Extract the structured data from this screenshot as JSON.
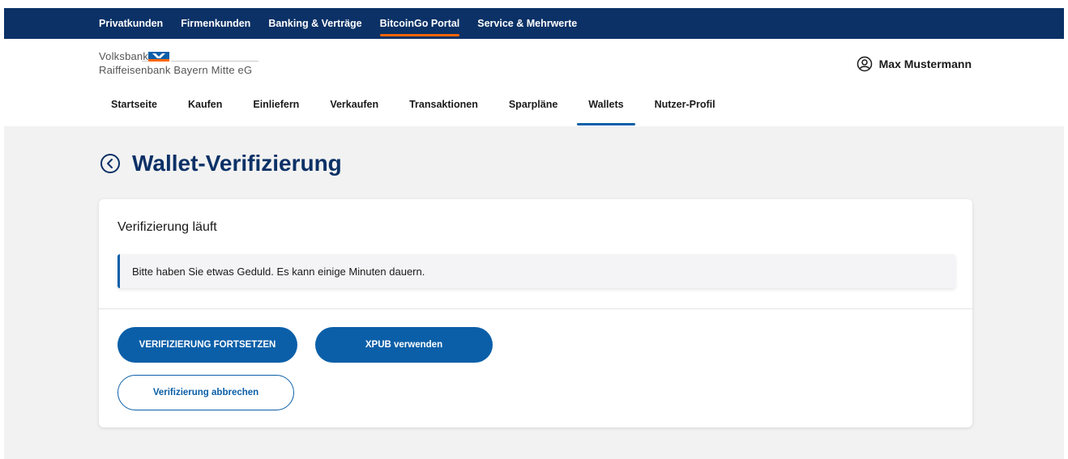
{
  "topnav": {
    "items": [
      {
        "label": "Privatkunden"
      },
      {
        "label": "Firmenkunden"
      },
      {
        "label": "Banking & Verträge"
      },
      {
        "label": "BitcoinGo Portal",
        "active": true
      },
      {
        "label": "Service & Mehrwerte"
      }
    ]
  },
  "header": {
    "logo_line1": "Volksbank",
    "logo_line2": "Raiffeisenbank Bayern Mitte eG",
    "user_name": "Max Mustermann"
  },
  "subnav": {
    "items": [
      {
        "label": "Startseite"
      },
      {
        "label": "Kaufen"
      },
      {
        "label": "Einliefern"
      },
      {
        "label": "Verkaufen"
      },
      {
        "label": "Transaktionen"
      },
      {
        "label": "Sparpläne"
      },
      {
        "label": "Wallets",
        "active": true
      },
      {
        "label": "Nutzer-Profil"
      }
    ]
  },
  "page": {
    "title": "Wallet-Verifizierung"
  },
  "card": {
    "heading": "Verifizierung läuft",
    "notice": "Bitte haben Sie etwas Geduld. Es kann einige Minuten dauern.",
    "continue_label": "VERIFIZIERUNG FORTSETZEN",
    "xpub_label": "XPUB verwenden",
    "cancel_label": "Verifizierung abbrechen"
  },
  "colors": {
    "navy": "#0b3166",
    "primary_blue": "#0b5fa8",
    "accent_orange": "#ff6600",
    "page_bg": "#f2f2f2"
  },
  "icons": {
    "user": "user-circle-icon",
    "back": "chevron-left-circle-icon",
    "logo_mark": "volksbank-logo-mark"
  }
}
